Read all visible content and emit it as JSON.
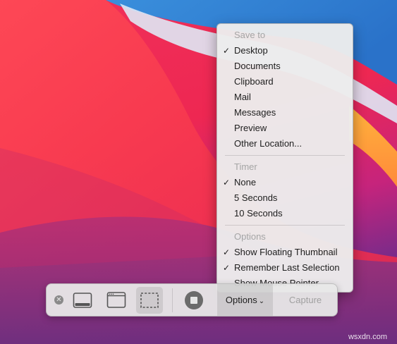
{
  "menu": {
    "sections": [
      {
        "header": "Save to",
        "items": [
          {
            "label": "Desktop",
            "checked": true
          },
          {
            "label": "Documents",
            "checked": false
          },
          {
            "label": "Clipboard",
            "checked": false
          },
          {
            "label": "Mail",
            "checked": false
          },
          {
            "label": "Messages",
            "checked": false
          },
          {
            "label": "Preview",
            "checked": false
          },
          {
            "label": "Other Location...",
            "checked": false
          }
        ]
      },
      {
        "header": "Timer",
        "items": [
          {
            "label": "None",
            "checked": true
          },
          {
            "label": "5 Seconds",
            "checked": false
          },
          {
            "label": "10 Seconds",
            "checked": false
          }
        ]
      },
      {
        "header": "Options",
        "items": [
          {
            "label": "Show Floating Thumbnail",
            "checked": true
          },
          {
            "label": "Remember Last Selection",
            "checked": true
          },
          {
            "label": "Show Mouse Pointer",
            "checked": false
          }
        ]
      }
    ],
    "check_glyph": "✓"
  },
  "toolbar": {
    "options_label": "Options",
    "options_chevron": "⌄",
    "capture_label": "Capture",
    "close_glyph": "✕",
    "selected_mode": "capture-selected-portion"
  },
  "watermark": "wsxdn.com"
}
